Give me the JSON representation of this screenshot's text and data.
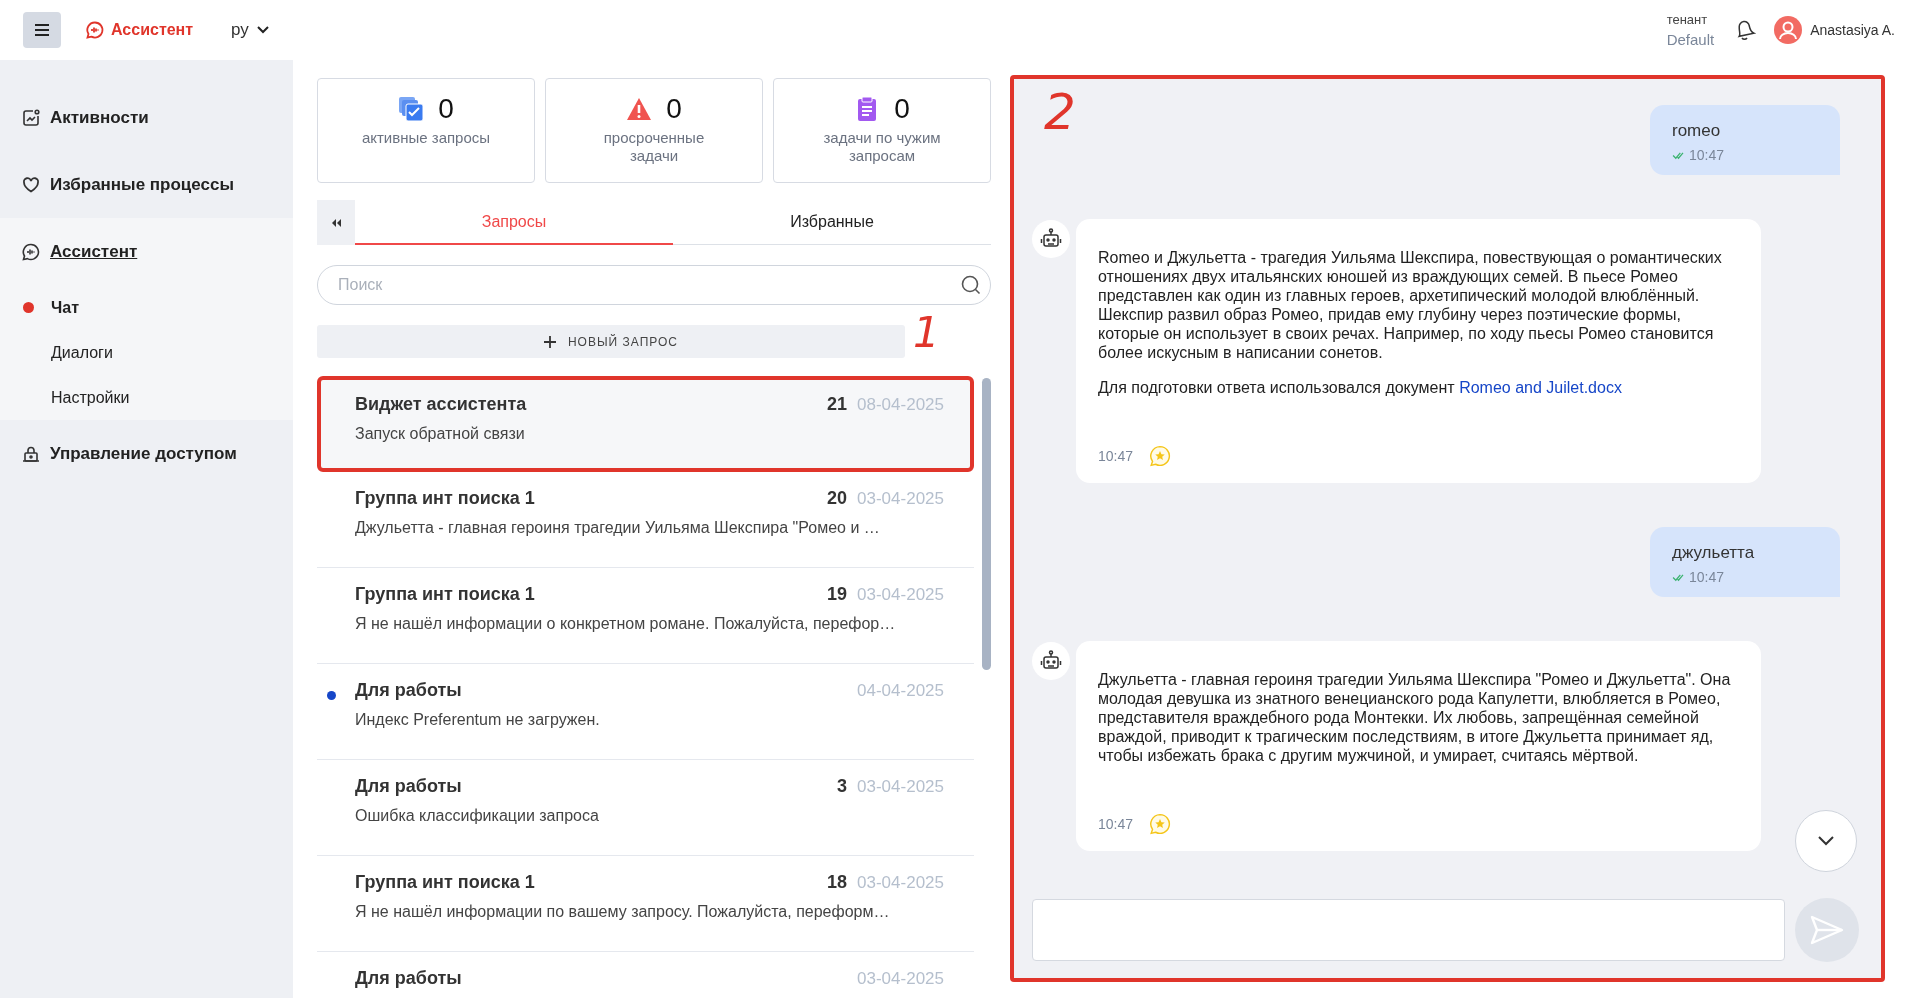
{
  "header": {
    "app_name": "Ассистент",
    "language": "ру",
    "tenant_label": "тенант",
    "tenant": "Default",
    "user": "Anastasiya A."
  },
  "sidebar": {
    "items": [
      {
        "label": "Активности",
        "kind": "activity",
        "selected": false
      },
      {
        "label": "Избранные процессы",
        "kind": "favorites",
        "selected": false
      },
      {
        "label": "Ассистент",
        "kind": "assistant",
        "selected": true,
        "expanded": true,
        "children": [
          {
            "label": "Чат",
            "selected": true
          },
          {
            "label": "Диалоги",
            "selected": false
          },
          {
            "label": "Настройки",
            "selected": false
          }
        ]
      },
      {
        "label": "Управление доступом",
        "kind": "access",
        "selected": false
      }
    ]
  },
  "stats": [
    {
      "kind": "active",
      "value": "0",
      "label": "активные запросы"
    },
    {
      "kind": "overdue",
      "value": "0",
      "label": "просроченные задачи"
    },
    {
      "kind": "foreign",
      "value": "0",
      "label": "задачи по чужим запросам"
    }
  ],
  "tabs": [
    {
      "label": "Запросы",
      "selected": true
    },
    {
      "label": "Избранные",
      "selected": false
    }
  ],
  "search": {
    "placeholder": "Поиск"
  },
  "new_request_button": "НОВЫЙ ЗАПРОС",
  "requests": {
    "annotation": "1",
    "items": [
      {
        "title": "Виджет ассистента",
        "count": "21",
        "date": "08-04-2025",
        "subtitle": "Запуск обратной связи",
        "selected": true,
        "unread": false
      },
      {
        "title": "Группа инт поиска 1",
        "count": "20",
        "date": "03-04-2025",
        "subtitle": "Джульетта - главная героиня трагедии Уильяма Шекспира \"Ромео и …",
        "selected": false,
        "unread": false
      },
      {
        "title": "Группа инт поиска 1",
        "count": "19",
        "date": "03-04-2025",
        "subtitle": "Я не нашёл информации о конкретном романе. Пожалуйста, перефор…",
        "selected": false,
        "unread": false
      },
      {
        "title": "Для работы",
        "date": "04-04-2025",
        "subtitle": "Индекс Preferentum не загружен.",
        "selected": false,
        "unread": true
      },
      {
        "title": "Для работы",
        "count": "3",
        "date": "03-04-2025",
        "subtitle": "Ошибка классификации запроса",
        "selected": false,
        "unread": false
      },
      {
        "title": "Группа инт поиска 1",
        "count": "18",
        "date": "03-04-2025",
        "subtitle": "Я не нашёл информации по вашему запросу. Пожалуйста, переформ…",
        "selected": false,
        "unread": false
      },
      {
        "title": "Для работы",
        "date": "03-04-2025",
        "selected": false,
        "unread": false
      }
    ]
  },
  "chat": {
    "annotation": "2",
    "messages": [
      {
        "kind": "user",
        "text": "romeo",
        "time": "10:47"
      },
      {
        "kind": "bot",
        "paragraphs": [
          {
            "text": "Romeo и Джульетта - трагедия Уильяма Шекспира, повествующая о романтических отношениях двух итальянских юношей из враждующих семей. В пьесе Ромео представлен как один из главных героев, архетипический молодой влюблённый. Шекспир развил образ Ромео, придав ему глубину через поэтические формы, которые он использует в своих речах. Например, по ходу пьесы Ромео становится более искусным в написании сонетов."
          },
          {
            "text": "Для подготовки ответа использовался документ",
            "link": "Romeo and Juilet.docx"
          }
        ],
        "time": "10:47"
      },
      {
        "kind": "user",
        "text": "джульетта",
        "time": "10:47"
      },
      {
        "kind": "bot",
        "paragraphs": [
          {
            "text": "Джульетта - главная героиня трагедии Уильяма Шекспира \"Ромео и Джульетта\". Она молодая девушка из знатного венецианского рода Капулетти, влюбляется в Ромео, представителя враждебного рода Монтекки. Их любовь, запрещённая семейной враждой, приводит к трагическим последствиям, в итоге Джульетта принимает яд, чтобы избежать брака с другим мужчиной, и умирает, считаясь мёртвой."
          }
        ],
        "time": "10:47"
      }
    ]
  }
}
